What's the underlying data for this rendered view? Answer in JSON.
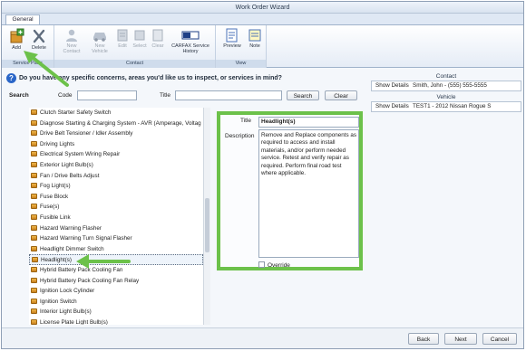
{
  "window": {
    "title": "Work Order Wizard"
  },
  "tabs": [
    {
      "label": "General"
    }
  ],
  "ribbon": {
    "groups": [
      {
        "label": "Service Parts",
        "buttons": [
          {
            "label": "Add",
            "icon": "box-add-icon"
          },
          {
            "label": "Delete",
            "icon": "x-delete-icon"
          }
        ]
      },
      {
        "label": "Contact",
        "buttons": [
          {
            "label": "New Contact",
            "icon": "person-icon"
          },
          {
            "label": "New Vehicle",
            "icon": "car-icon"
          },
          {
            "label": "Edit",
            "icon": "edit-icon"
          },
          {
            "label": "Select",
            "icon": "select-icon"
          },
          {
            "label": "Clear",
            "icon": "clear-icon"
          },
          {
            "label": "CARFAX Service History",
            "icon": "carfax-icon"
          }
        ]
      },
      {
        "label": "View",
        "buttons": [
          {
            "label": "Preview",
            "icon": "preview-icon"
          },
          {
            "label": "Note",
            "icon": "note-icon"
          }
        ]
      }
    ]
  },
  "question": "Do you have any specific concerns, areas you'd like us to inspect, or services in mind?",
  "search": {
    "label": "Search",
    "code_label": "Code",
    "code_value": "",
    "title_label": "Title",
    "title_value": "",
    "search_button": "Search",
    "clear_button": "Clear"
  },
  "parts_list": [
    "Clutch Starter Safety Switch",
    "Diagnose Starting & Charging System - AVR (Amperage, Voltag",
    "Drive Belt Tensioner / Idler Assembly",
    "Driving Lights",
    "Electrical System Wiring Repair",
    "Exterior Light Bulb(s)",
    "Fan / Drive Belts Adjust",
    "Fog Light(s)",
    "Fuse Block",
    "Fuse(s)",
    "Fusible Link",
    "Hazard Warning Flasher",
    "Hazard Warning Turn Signal Flasher",
    "Headlight Dimmer Switch",
    "Headlight(s)",
    "Hybrid Battery Pack Cooling Fan",
    "Hybrid Battery Pack Cooling Fan Relay",
    "Ignition Lock Cylinder",
    "Ignition Switch",
    "Interior Light Bulb(s)",
    "License Plate Light Bulb(s)"
  ],
  "selected_index": 14,
  "detail": {
    "title_label": "Title",
    "title_value": "Headlight(s)",
    "description_label": "Description",
    "description_value": "Remove and Replace components as required to access and install materials, and/or perform needed service.  Retest and verify repair as required.  Perform final road test where applicable.",
    "override_label": "Override",
    "override_checked": false
  },
  "contact": {
    "header": "Contact",
    "show_details": "Show Details",
    "value": "Smith, John - (555) 555-5555"
  },
  "vehicle": {
    "header": "Vehicle",
    "show_details": "Show Details",
    "value": "TEST1 - 2012 Nissan Rogue S"
  },
  "footer": {
    "back": "Back",
    "next": "Next",
    "cancel": "Cancel"
  },
  "colors": {
    "highlight": "#6cc14a",
    "ribbon_label_bg": "#cfdcec",
    "accent": "#2a66c8"
  }
}
